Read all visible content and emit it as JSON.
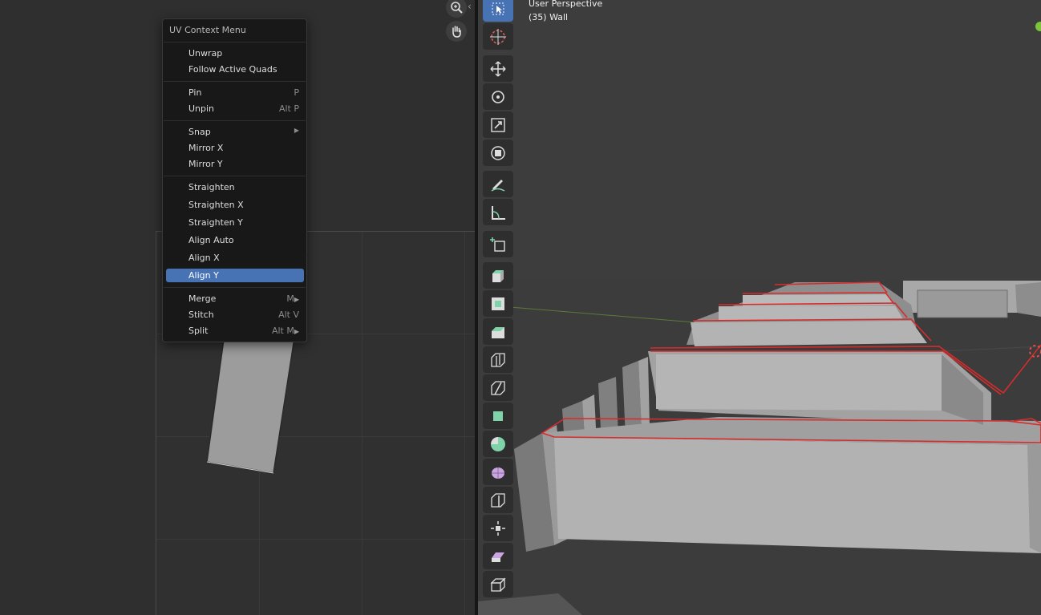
{
  "uv_editor": {
    "nav_icons": [
      "zoom-icon",
      "pan-hand-icon"
    ]
  },
  "context_menu": {
    "title": "UV Context Menu",
    "groups": [
      [
        {
          "label": "Unwrap",
          "shortcut": ""
        },
        {
          "label": "Follow Active Quads",
          "shortcut": ""
        }
      ],
      [
        {
          "label": "Pin",
          "shortcut": "P"
        },
        {
          "label": "Unpin",
          "shortcut": "Alt P"
        }
      ],
      [
        {
          "label": "Snap",
          "shortcut": "",
          "submenu": true
        },
        {
          "label": "Mirror X",
          "shortcut": ""
        },
        {
          "label": "Mirror Y",
          "shortcut": ""
        }
      ],
      [
        {
          "label": "Straighten",
          "shortcut": ""
        },
        {
          "label": "Straighten X",
          "shortcut": ""
        },
        {
          "label": "Straighten Y",
          "shortcut": ""
        },
        {
          "label": "Align Auto",
          "shortcut": ""
        },
        {
          "label": "Align X",
          "shortcut": ""
        },
        {
          "label": "Align Y",
          "shortcut": "",
          "active": true
        }
      ],
      [
        {
          "label": "Merge",
          "shortcut": "M",
          "submenu": true
        },
        {
          "label": "Stitch",
          "shortcut": "Alt V"
        },
        {
          "label": "Split",
          "shortcut": "Alt M",
          "submenu": true
        }
      ]
    ]
  },
  "viewport": {
    "view_name": "User Perspective",
    "object_info": "(35) Wall",
    "accent_color": "#4772b3",
    "edge_select_color": "#d62c2c",
    "toolbar": [
      {
        "name": "select-box-icon",
        "active": true
      },
      {
        "name": "cursor-icon"
      },
      {
        "name": "move-icon"
      },
      {
        "name": "rotate-icon"
      },
      {
        "name": "scale-icon"
      },
      {
        "name": "transform-icon"
      },
      {
        "name": "annotate-icon"
      },
      {
        "name": "measure-icon"
      },
      {
        "name": "add-cube-icon"
      },
      {
        "name": "extrude-region-icon"
      },
      {
        "name": "inset-faces-icon"
      },
      {
        "name": "bevel-icon"
      },
      {
        "name": "loop-cut-icon"
      },
      {
        "name": "knife-icon"
      },
      {
        "name": "poly-build-icon"
      },
      {
        "name": "spin-icon"
      },
      {
        "name": "smooth-icon"
      },
      {
        "name": "edge-slide-icon"
      },
      {
        "name": "shrink-fatten-icon"
      },
      {
        "name": "shear-icon"
      },
      {
        "name": "rip-region-icon"
      }
    ]
  }
}
